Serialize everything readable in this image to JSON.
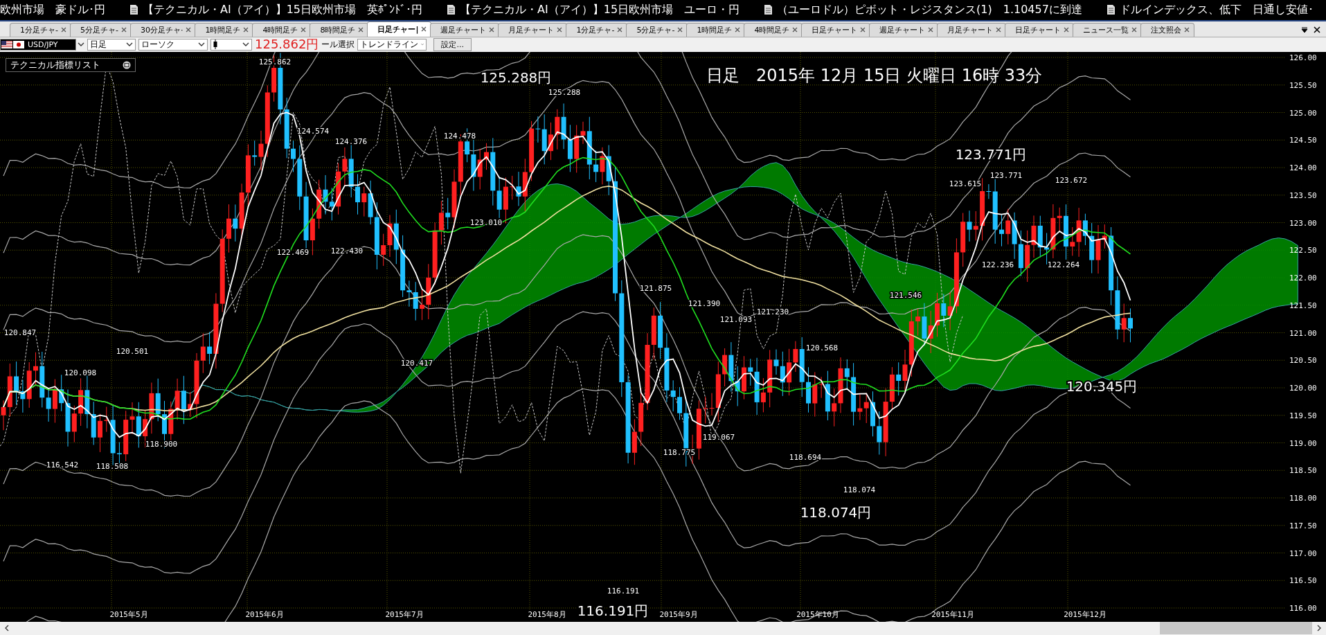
{
  "news_ticker": [
    {
      "text": "欧州市場　豪ドル･円",
      "has_icon": false
    },
    {
      "text": "【テクニカル・AI（アイ）】15日欧州市場　英ﾎﾟﾝﾄﾞ･円",
      "has_icon": true
    },
    {
      "text": "【テクニカル・AI（アイ）】15日欧州市場　ユーロ・円",
      "has_icon": true
    },
    {
      "text": "（ユーロドル）ピボット・レジスタンス(1)　1.10457に到達",
      "has_icon": true
    },
    {
      "text": "ドルインデックス、低下　日通し安値･",
      "has_icon": true
    }
  ],
  "tabs": [
    {
      "label": "1分足チャ‐",
      "selected": false
    },
    {
      "label": "5分足チャ‐",
      "selected": false
    },
    {
      "label": "30分足チャ·",
      "selected": false
    },
    {
      "label": "1時間足チ",
      "selected": false
    },
    {
      "label": "4時間足チ",
      "selected": false
    },
    {
      "label": "8時間足チ",
      "selected": false
    },
    {
      "label": "日足チャー|",
      "selected": true
    },
    {
      "label": "週足チャート",
      "selected": false
    },
    {
      "label": "月足チャート",
      "selected": false
    },
    {
      "label": "1分足チャ‐",
      "selected": false
    },
    {
      "label": "5分足チャ‐",
      "selected": false
    },
    {
      "label": "1時間足チ",
      "selected": false
    },
    {
      "label": "4時間足チ",
      "selected": false
    },
    {
      "label": "日足チャート",
      "selected": false
    },
    {
      "label": "週足チャート",
      "selected": false
    },
    {
      "label": "月足チャート",
      "selected": false
    },
    {
      "label": "日足チャート",
      "selected": false
    },
    {
      "label": "ニュース一覧",
      "selected": false
    },
    {
      "label": "注文照会",
      "selected": false
    }
  ],
  "toolbar": {
    "symbol": "USD/JPY",
    "timeframe": "日足",
    "chart_type": "ローソク",
    "high_price": "125.862円",
    "tool_label": "ール選択",
    "drawing_tool": "トレンドライン",
    "settings_button": "設定..."
  },
  "indicator_panel": {
    "title": "テクニカル指標リスト"
  },
  "chart": {
    "title": "日足　2015年 12月 15日 火曜日 16時 33分",
    "big_labels": [
      "125.288円",
      "123.771円",
      "120.345円",
      "118.074円",
      "116.191円"
    ],
    "price_labels": [
      "125.862",
      "124.574",
      "124.376",
      "124.478",
      "125.288",
      "123.010",
      "122.469",
      "122.430",
      "120.847",
      "120.501",
      "120.098",
      "120.417",
      "118.900",
      "116.542",
      "118.508",
      "121.875",
      "121.390",
      "121.093",
      "121.230",
      "120.568",
      "121.546",
      "118.775",
      "119.067",
      "118.694",
      "118.074",
      "116.191",
      "123.615",
      "123.771",
      "123.672",
      "122.236",
      "122.264"
    ],
    "y_labels": [
      "126.00",
      "125.50",
      "125.00",
      "124.50",
      "124.00",
      "123.50",
      "123.00",
      "122.50",
      "122.00",
      "121.50",
      "121.00",
      "120.50",
      "120.00",
      "119.50",
      "119.00",
      "118.50",
      "118.00",
      "117.50",
      "117.00",
      "116.50",
      "116.00"
    ],
    "x_labels": [
      "2015年5月",
      "2015年6月",
      "2015年7月",
      "2015年8月",
      "2015年9月",
      "2015年10月",
      "2015年11月",
      "2015年12月"
    ]
  }
}
